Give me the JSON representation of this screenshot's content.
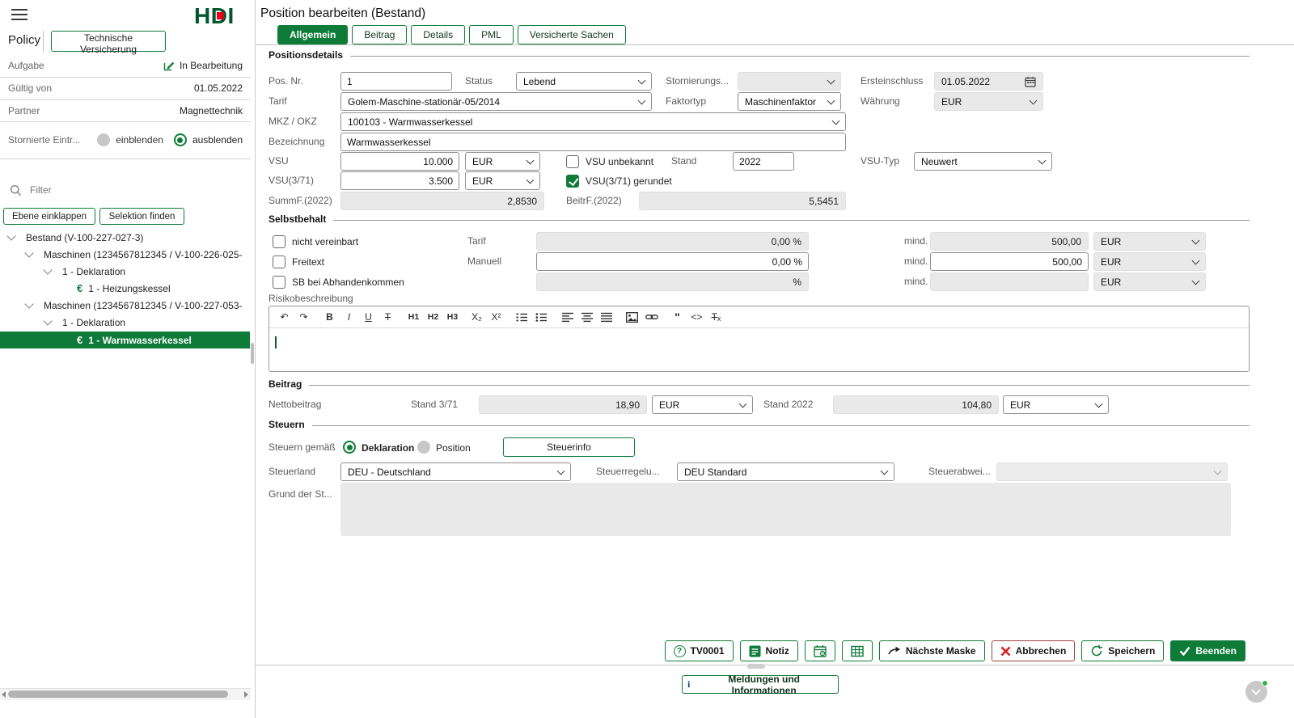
{
  "colors": {
    "green": "#0E7C38",
    "logo_green": "#00572F",
    "logo_red": "#E2001A",
    "cancel_red": "#D61A1A",
    "readonly_bg": "#E9E9E9"
  },
  "sidebar": {
    "logo": [
      "H",
      "D",
      "I"
    ],
    "title": "Policy",
    "context_button": "Technische Versicherung",
    "aufgabe": {
      "label": "Aufgabe",
      "value": "In Bearbeitung"
    },
    "gueltig_von": {
      "label": "Gültig von",
      "value": "01.05.2022"
    },
    "partner": {
      "label": "Partner",
      "value": "Magnettechnik"
    },
    "stornierte": {
      "label": "Stornierte Eintr...",
      "show_option": "einblenden",
      "hide_option": "ausblenden",
      "selected": "ausblenden"
    },
    "filter_placeholder": "Filter",
    "collapse_button": "Ebene einklappen",
    "find_button": "Selektion finden",
    "tree": [
      {
        "label": "Bestand (V-100-227-027-3)",
        "level": 0,
        "expanded": true
      },
      {
        "label": "Maschinen (1234567812345 / V-100-226-025-",
        "level": 1,
        "expanded": true
      },
      {
        "label": "1 - Deklaration",
        "level": 2,
        "expanded": true
      },
      {
        "label": "1 - Heizungskessel",
        "level": 3,
        "icon": "euro",
        "selected": false
      },
      {
        "label": "Maschinen (1234567812345 / V-100-227-053-",
        "level": 1,
        "expanded": true
      },
      {
        "label": "1 - Deklaration",
        "level": 2,
        "expanded": true
      },
      {
        "label": "1 - Warmwasserkessel",
        "level": 3,
        "icon": "euro",
        "selected": true
      }
    ]
  },
  "main": {
    "title": "Position bearbeiten (Bestand)",
    "tabs": [
      {
        "label": "Allgemein",
        "active": true
      },
      {
        "label": "Beitrag",
        "active": false
      },
      {
        "label": "Details",
        "active": false
      },
      {
        "label": "PML",
        "active": false
      },
      {
        "label": "Versicherte Sachen",
        "active": false
      }
    ],
    "positionsdetails": {
      "heading": "Positionsdetails",
      "pos_nr_label": "Pos. Nr.",
      "pos_nr": "1",
      "status_label": "Status",
      "status": "Lebend",
      "stornierungs_label": "Stornierungs...",
      "stornierungs": "",
      "ersteinschluss_label": "Ersteinschluss",
      "ersteinschluss": "01.05.2022",
      "tarif_label": "Tarif",
      "tarif": "Golem-Maschine-stationär-05/2014",
      "faktortyp_label": "Faktortyp",
      "faktortyp": "Maschinenfaktor",
      "waehrung_label": "Währung",
      "waehrung": "EUR",
      "mkz_label": "MKZ / OKZ",
      "mkz": "100103 - Warmwasserkessel",
      "bezeichnung_label": "Bezeichnung",
      "bezeichnung": "Warmwasserkessel",
      "vsu_label": "VSU",
      "vsu": "10.000",
      "vsu_currency": "EUR",
      "vsu_unbekannt_label": "VSU unbekannt",
      "vsu_unbekannt_checked": false,
      "stand_label": "Stand",
      "stand": "2022",
      "vsu_typ_label": "VSU-Typ",
      "vsu_typ": "Neuwert",
      "vsu371_label": "VSU(3/71)",
      "vsu371": "3.500",
      "vsu371_currency": "EUR",
      "vsu371_gerundet_label": "VSU(3/71) gerundet",
      "vsu371_gerundet_checked": true,
      "summf_label": "SummF.(2022)",
      "summf": "2,8530",
      "beitrf_label": "BeitrF.(2022)",
      "beitrf": "5,5451"
    },
    "selbstbehalt": {
      "heading": "Selbstbehalt",
      "rows": [
        {
          "checkbox": "nicht vereinbart",
          "checked": false,
          "label": "Tarif",
          "value": "0,00 %",
          "readonly": true,
          "mind_label": "mind.",
          "mind": "500,00",
          "mind_readonly": true,
          "currency": "EUR"
        },
        {
          "checkbox": "Freitext",
          "checked": false,
          "label": "Manuell",
          "value": "0,00 %",
          "readonly": false,
          "mind_label": "mind.",
          "mind": "500,00",
          "mind_readonly": false,
          "currency": "EUR"
        },
        {
          "checkbox": "SB bei Abhandenkommen",
          "checked": false,
          "label": "",
          "value": "%",
          "readonly": true,
          "mind_label": "mind.",
          "mind": "",
          "mind_readonly": true,
          "currency": "EUR"
        }
      ]
    },
    "risiko": {
      "label": "Risikobeschreibung",
      "toolbar": [
        "undo",
        "redo",
        "bold",
        "italic",
        "underline",
        "strikethrough",
        "h1",
        "h2",
        "h3",
        "subscript",
        "superscript",
        "ordered-list",
        "bullet-list",
        "align-left",
        "align-center",
        "align-justify",
        "image",
        "link",
        "quote",
        "code",
        "clear-format"
      ],
      "content": ""
    },
    "beitrag": {
      "heading": "Beitrag",
      "netto_label": "Nettobeitrag",
      "stand371_label": "Stand 3/71",
      "stand371": "18,90",
      "stand371_currency": "EUR",
      "stand2022_label": "Stand 2022",
      "stand2022": "104,80",
      "stand2022_currency": "EUR"
    },
    "steuern": {
      "heading": "Steuern",
      "gemaess_label": "Steuern gemäß",
      "radio_deklaration": "Deklaration",
      "radio_position": "Position",
      "selected": "Deklaration",
      "steuerinfo_button": "Steuerinfo",
      "steuerland_label": "Steuerland",
      "steuerland": "DEU - Deutschland",
      "steuerregelung_label": "Steuerregelu...",
      "steuerregelung": "DEU Standard",
      "steuerabweichung_label": "Steuerabwei...",
      "steuerabweichung": "",
      "grund_label": "Grund der St...",
      "grund": ""
    },
    "footer": {
      "tv_button": "TV0001",
      "notiz_button": "Notiz",
      "naechste_button": "Nächste Maske",
      "abbrechen_button": "Abbrechen",
      "speichern_button": "Speichern",
      "beenden_button": "Beenden",
      "icon_names": [
        "help-circle",
        "note",
        "calendar",
        "table",
        "arrow-right",
        "x-cancel",
        "save-refresh",
        "check"
      ]
    },
    "messages_button": "Meldungen und Informationen"
  }
}
